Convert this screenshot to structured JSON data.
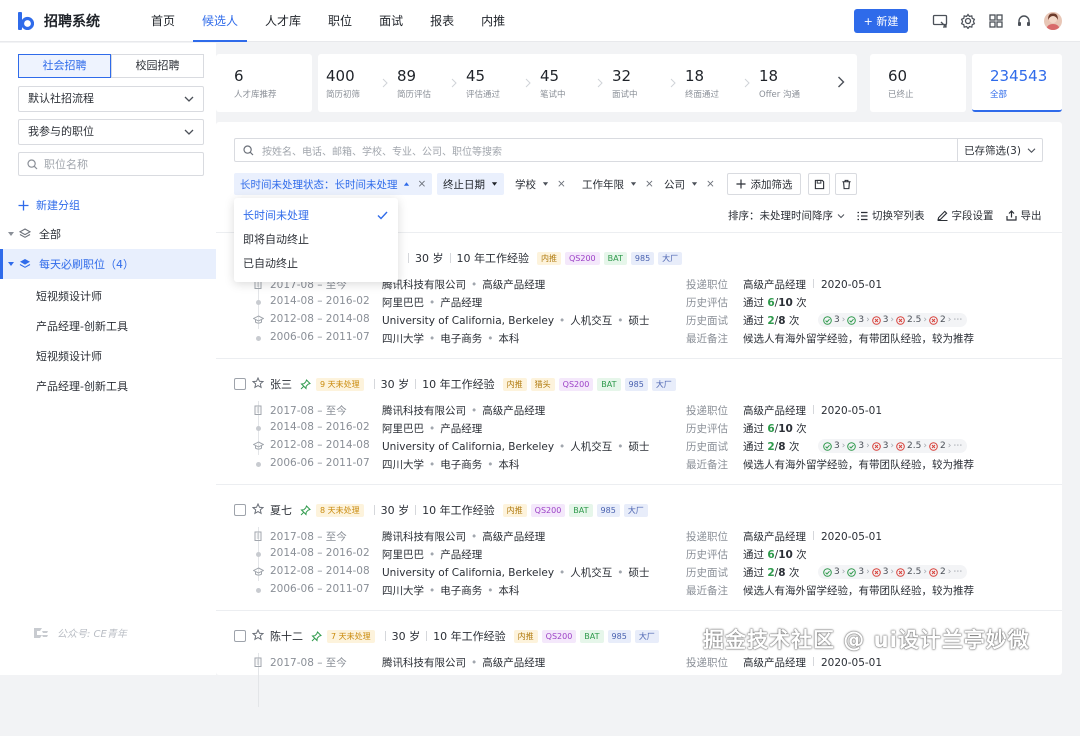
{
  "app": {
    "title": "招聘系统"
  },
  "nav": [
    "首页",
    "候选人",
    "人才库",
    "职位",
    "面试",
    "报表",
    "内推"
  ],
  "nav_active": 1,
  "top_actions": {
    "new_label": "+ 新建"
  },
  "sidebar": {
    "segments": [
      "社会招聘",
      "校园招聘"
    ],
    "flow_select": "默认社招流程",
    "job_select": "我参与的职位",
    "search_placeholder": "职位名称",
    "new_group": "新建分组",
    "tree_all": "全部",
    "tree_group": "每天必刷职位",
    "tree_group_count": "（4）",
    "leaves": [
      "短视频设计师",
      "产品经理-创新工具",
      "短视频设计师",
      "产品经理-创新工具"
    ],
    "watermark": "公众号: CE青年"
  },
  "stats": {
    "talent": {
      "value": "6",
      "label": "人才库推荐"
    },
    "funnel": [
      {
        "value": "400",
        "label": "简历初筛"
      },
      {
        "value": "89",
        "label": "简历评估"
      },
      {
        "value": "45",
        "label": "评估通过"
      },
      {
        "value": "45",
        "label": "笔试中"
      },
      {
        "value": "32",
        "label": "面试中"
      },
      {
        "value": "18",
        "label": "终面通过"
      },
      {
        "value": "18",
        "label": "Offer 沟通"
      }
    ],
    "ended": {
      "value": "60",
      "label": "已终止"
    },
    "all": {
      "value": "234543",
      "label": "全部"
    }
  },
  "search": {
    "placeholder": "按姓名、电话、邮箱、学校、专业、公司、职位等搜索",
    "saved_filters": "已存筛选(3)"
  },
  "filters": {
    "active_chip": "长时间未处理状态：长时间未处理",
    "date_chip": "终止日期",
    "school": "学校",
    "years": "工作年限",
    "company": "公司",
    "add": "添加筛选"
  },
  "sort": {
    "label": "排序：",
    "value": "未处理时间降序",
    "switch_view": "切换窄列表",
    "field_settings": "字段设置",
    "export": "导出"
  },
  "dropdown": {
    "items": [
      "长时间未处理",
      "即将自动终止",
      "已自动终止"
    ],
    "selected": 0
  },
  "labels": {
    "apply": "投递职位",
    "history_eval": "历史评估",
    "history_interview": "历史面试",
    "last_note": "最近备注"
  },
  "candidates": [
    {
      "name": "",
      "wait": "",
      "age": "30 岁",
      "exp": "10 年工作经验",
      "tags": [
        "内推",
        "QS200",
        "BAT",
        "985",
        "大厂"
      ],
      "jobs": [
        {
          "date": "2017-08 – 至今",
          "org": "腾讯科技有限公司",
          "role": "高级产品经理"
        },
        {
          "date": "2014-08 – 2016-02",
          "org": "阿里巴巴",
          "role": "产品经理"
        }
      ],
      "edu": [
        {
          "date": "2012-08 – 2014-08",
          "org": "University of California, Berkeley",
          "major": "人机交互",
          "degree": "硕士"
        },
        {
          "date": "2006-06 – 2011-07",
          "org": "四川大学",
          "major": "电子商务",
          "degree": "本科"
        }
      ],
      "apply": "高级产品经理",
      "apply_date": "2020-05-01",
      "eval": "通过 6/10 次",
      "eval_pass": "6",
      "eval_total": "10",
      "interview_pass": "2",
      "interview_total": "8",
      "stages": [
        "3",
        "3",
        "3",
        "2.5",
        "2"
      ],
      "note": "候选人有海外留学经验，有带团队经验，较为推荐"
    },
    {
      "name": "张三",
      "wait": "9 天未处理",
      "age": "30 岁",
      "exp": "10 年工作经验",
      "tags": [
        "内推",
        "猎头",
        "QS200",
        "BAT",
        "985",
        "大厂"
      ],
      "jobs": [
        {
          "date": "2017-08 – 至今",
          "org": "腾讯科技有限公司",
          "role": "高级产品经理"
        },
        {
          "date": "2014-08 – 2016-02",
          "org": "阿里巴巴",
          "role": "产品经理"
        }
      ],
      "edu": [
        {
          "date": "2012-08 – 2014-08",
          "org": "University of California, Berkeley",
          "major": "人机交互",
          "degree": "硕士"
        },
        {
          "date": "2006-06 – 2011-07",
          "org": "四川大学",
          "major": "电子商务",
          "degree": "本科"
        }
      ],
      "apply": "高级产品经理",
      "apply_date": "2020-05-01",
      "eval_pass": "6",
      "eval_total": "10",
      "interview_pass": "2",
      "interview_total": "8",
      "stages": [
        "3",
        "3",
        "3",
        "2.5",
        "2"
      ],
      "note": "候选人有海外留学经验，有带团队经验，较为推荐"
    },
    {
      "name": "夏七",
      "wait": "8 天未处理",
      "age": "30 岁",
      "exp": "10 年工作经验",
      "tags": [
        "内推",
        "QS200",
        "BAT",
        "985",
        "大厂"
      ],
      "jobs": [
        {
          "date": "2017-08 – 至今",
          "org": "腾讯科技有限公司",
          "role": "高级产品经理"
        },
        {
          "date": "2014-08 – 2016-02",
          "org": "阿里巴巴",
          "role": "产品经理"
        }
      ],
      "edu": [
        {
          "date": "2012-08 – 2014-08",
          "org": "University of California, Berkeley",
          "major": "人机交互",
          "degree": "硕士"
        },
        {
          "date": "2006-06 – 2011-07",
          "org": "四川大学",
          "major": "电子商务",
          "degree": "本科"
        }
      ],
      "apply": "高级产品经理",
      "apply_date": "2020-05-01",
      "eval_pass": "6",
      "eval_total": "10",
      "interview_pass": "2",
      "interview_total": "8",
      "stages": [
        "3",
        "3",
        "3",
        "2.5",
        "2"
      ],
      "note": "候选人有海外留学经验，有带团队经验，较为推荐"
    },
    {
      "name": "陈十二",
      "wait": "7 天未处理",
      "age": "30 岁",
      "exp": "10 年工作经验",
      "tags": [
        "内推",
        "QS200",
        "BAT",
        "985",
        "大厂"
      ],
      "jobs": [
        {
          "date": "2017-08 – 至今",
          "org": "腾讯科技有限公司",
          "role": "高级产品经理"
        }
      ],
      "apply": "高级产品经理",
      "apply_date": "2020-05-01"
    }
  ],
  "watermark_right": "掘金技术社区 @ ui设计兰亭妙微"
}
